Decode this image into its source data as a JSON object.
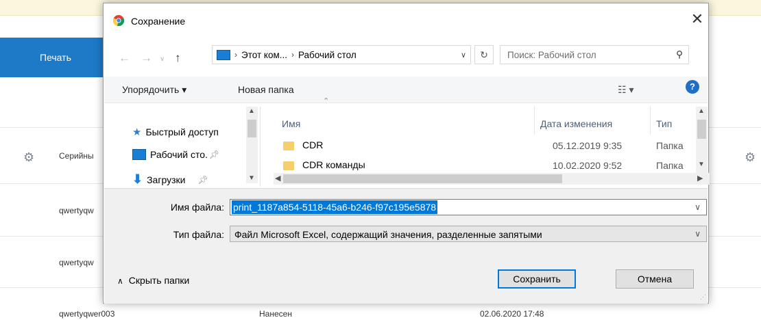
{
  "background_page": {
    "print_button": "Печать",
    "serial_header": "Серийны",
    "rows": [
      {
        "serial": "qwertyqw"
      },
      {
        "serial": "qwertyqw"
      },
      {
        "serial": "qwertyqwer003",
        "status": "Нанесен",
        "date": "02.06.2020 17:48"
      }
    ]
  },
  "dialog": {
    "title": "Сохранение",
    "address": {
      "segments": [
        "Этот ком...",
        "Рабочий стол"
      ]
    },
    "search_placeholder": "Поиск: Рабочий стол",
    "toolbar": {
      "organize": "Упорядочить ▾",
      "new_folder": "Новая папка"
    },
    "nav_pane": [
      {
        "label": "Быстрый доступ",
        "icon": "star-icon"
      },
      {
        "label": "Рабочий сто.",
        "icon": "desktop-icon"
      },
      {
        "label": "Загрузки",
        "icon": "download-icon"
      }
    ],
    "columns": {
      "name": "Имя",
      "date": "Дата изменения",
      "type": "Тип"
    },
    "files": [
      {
        "name": "CDR",
        "date": "05.12.2019 9:35",
        "type": "Папка"
      },
      {
        "name": "CDR команды",
        "date": "10.02.2020 9:52",
        "type": "Папка"
      }
    ],
    "filename_label": "Имя файла:",
    "filename_value": "print_1187a854-5118-45a6-b246-f97c195e5878",
    "filetype_label": "Тип файла:",
    "filetype_value": "Файл Microsoft Excel, содержащий значения, разделенные запятыми",
    "hide_folders": "Скрыть папки",
    "save_button": "Сохранить",
    "cancel_button": "Отмена"
  },
  "colors": {
    "accent": "#0078d7",
    "print_button_bg": "#1e79c7",
    "banner_bg": "#fbf6dd"
  }
}
